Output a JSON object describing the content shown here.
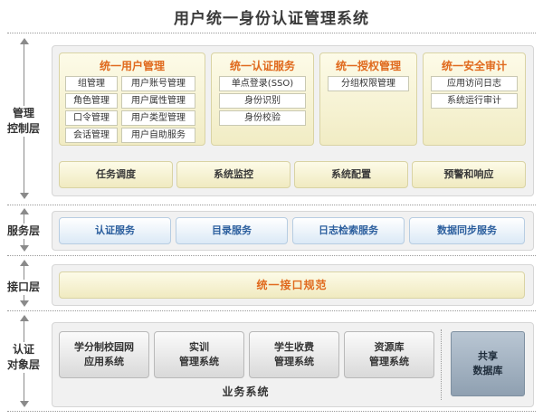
{
  "title": "用户统一身份认证管理系统",
  "layers": {
    "management": "管理控制层",
    "service": "服务层",
    "interface": "接口层",
    "object": "认证对象层"
  },
  "management": {
    "cards": [
      {
        "title": "统一用户管理",
        "items": [
          "组管理",
          "用户账号管理",
          "角色管理",
          "用户属性管理",
          "口令管理",
          "用户类型管理",
          "会话管理",
          "用户自助服务"
        ]
      },
      {
        "title": "统一认证服务",
        "items": [
          "单点登录(SSO)",
          "身份识别",
          "身份校验"
        ]
      },
      {
        "title": "统一授权管理",
        "items": [
          "分组权限管理"
        ]
      },
      {
        "title": "统一安全审计",
        "items": [
          "应用访问日志",
          "系统运行审计"
        ]
      }
    ],
    "bars": [
      "任务调度",
      "系统监控",
      "系统配置",
      "预警和响应"
    ]
  },
  "services": [
    "认证服务",
    "目录服务",
    "日志检索服务",
    "数据同步服务"
  ],
  "interface_spec": "统一接口规范",
  "objects": {
    "systems": [
      {
        "line1": "学分制校园网",
        "line2": "应用系统"
      },
      {
        "line1": "实训",
        "line2": "管理系统"
      },
      {
        "line1": "学生收费",
        "line2": "管理系统"
      },
      {
        "line1": "资源库",
        "line2": "管理系统"
      }
    ],
    "business_label": "业务系统",
    "shared": {
      "line1": "共享",
      "line2": "数据库"
    }
  }
}
